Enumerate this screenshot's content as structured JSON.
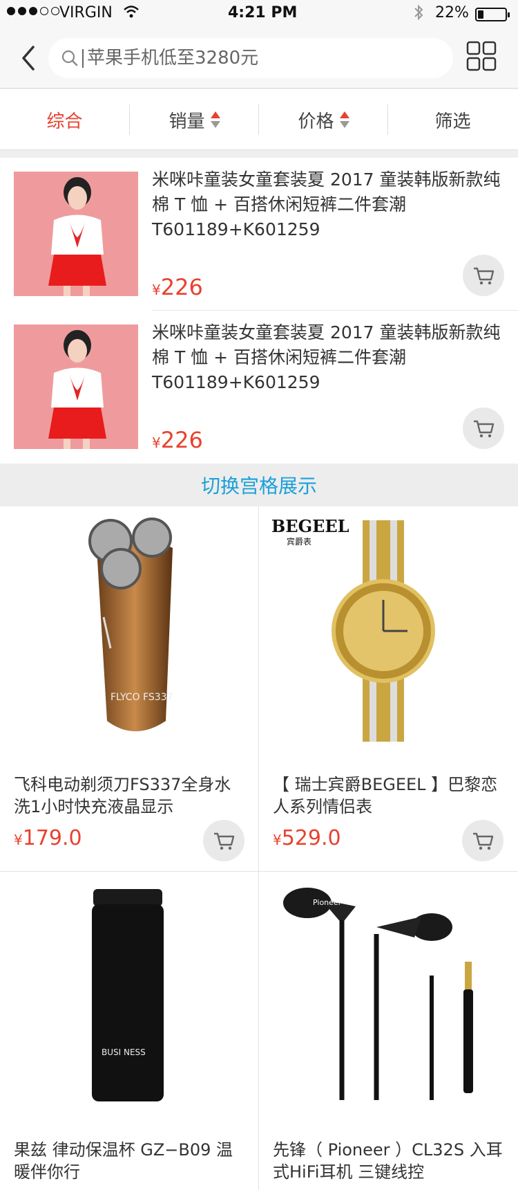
{
  "status_bar": {
    "carrier": "VIRGIN",
    "time": "4:21 PM",
    "battery_percent": "22%",
    "battery_level": 0.22,
    "signal_bars": 3
  },
  "header": {
    "search_placeholder": "苹果手机低至3280元",
    "back_icon": "chevron-left-icon",
    "layout_icon": "grid-view-icon"
  },
  "sort_tabs": [
    {
      "label": "综合",
      "active": true
    },
    {
      "label": "销量",
      "sortable": true
    },
    {
      "label": "价格",
      "sortable": true
    },
    {
      "label": "筛选"
    }
  ],
  "list_items": [
    {
      "title": "米咪咔童装女童套装夏 2017 童装韩版新款纯棉 T 恤 + 百搭休闲短裤二件套潮 T601189+K601259",
      "currency": "¥",
      "price": "226"
    },
    {
      "title": "米咪咔童装女童套装夏 2017 童装韩版新款纯棉 T 恤 + 百搭休闲短裤二件套潮 T601189+K601259",
      "currency": "¥",
      "price": "226"
    }
  ],
  "switch_label": "切换宫格展示",
  "grid_items": [
    {
      "title": "飞科电动剃须刀FS337全身水洗1小时快充液晶显示",
      "currency": "¥",
      "price": "179.0",
      "image_text": "FLYCO FS337"
    },
    {
      "title": "【 瑞士宾爵BEGEEL 】巴黎恋人系列情侣表",
      "currency": "¥",
      "price": "529.0",
      "brand": "BEGEEL",
      "brand_sub": "宾爵表"
    },
    {
      "title": "果兹 律动保温杯 GZ−B09 温暖伴你行",
      "currency": "",
      "price": "",
      "image_text": "BUSI NESS"
    },
    {
      "title": "先锋（ Pioneer ）CL32S 入耳式HiFi耳机 三键线控",
      "currency": "",
      "price": "",
      "image_text": "Pioneer"
    }
  ],
  "colors": {
    "accent": "#e8412e",
    "link": "#1aa0d9"
  }
}
